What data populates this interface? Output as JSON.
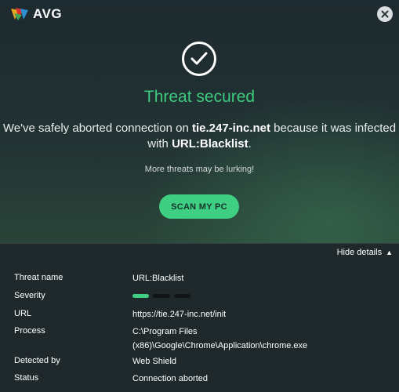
{
  "header": {
    "brand": "AVG"
  },
  "alert": {
    "title": "Threat secured",
    "message_prefix": "We've safely aborted connection on ",
    "domain": "tie.247-inc.net",
    "message_middle": " because it was infected with ",
    "threat": "URL:Blacklist",
    "message_suffix": ".",
    "lurking": "More threats may be lurking!",
    "scan_button": "SCAN MY PC"
  },
  "details": {
    "toggle_label": "Hide details",
    "rows": [
      {
        "label": "Threat name",
        "value": "URL:Blacklist"
      },
      {
        "label": "Severity",
        "value": ""
      },
      {
        "label": "URL",
        "value": "https://tie.247-inc.net/init"
      },
      {
        "label": "Process",
        "value_line1": "C:\\Program Files",
        "value_line2": "(x86)\\Google\\Chrome\\Application\\chrome.exe"
      },
      {
        "label": "Detected by",
        "value": "Web Shield"
      },
      {
        "label": "Status",
        "value": "Connection aborted"
      }
    ],
    "severity_level": 1,
    "severity_max": 3
  },
  "colors": {
    "accent": "#3ecb7f",
    "severity_on": "#3ecf83",
    "severity_off": "#111518"
  },
  "icons": {
    "logo": "avg-logo-icon",
    "close": "close-icon",
    "check": "check-icon",
    "caret": "caret-up-icon"
  }
}
